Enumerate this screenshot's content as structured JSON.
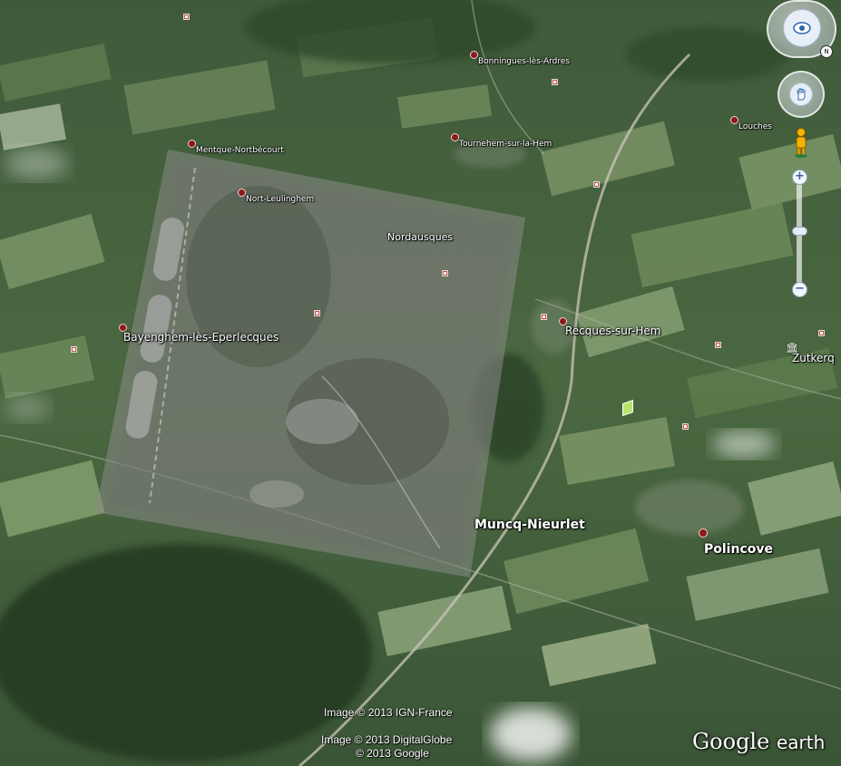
{
  "places": {
    "bonningues": "Bonningues-lès-Ardres",
    "louches": "Louches",
    "mentque": "Mentque-Nortbécourt",
    "tournehem": "Tournehem-sur-la-Hem",
    "nort": "Nort-Leulinghem",
    "nordausques": "Nordausques",
    "recques": "Recques-sur-Hem",
    "bayenghem": "Bayenghem-lès-Eperlecques",
    "zutkerque": "Zutkerq",
    "muncq": "Muncq-Nieurlet",
    "polincove": "Polincove"
  },
  "credits": {
    "ign": "Image © 2013 IGN-France",
    "digitalglobe": "Image © 2013 DigitalGlobe",
    "google": "© 2013 Google"
  },
  "logo": {
    "brand": "Google",
    "product": "earth"
  },
  "controls": {
    "zoom_in": "+",
    "zoom_out": "−"
  },
  "icons": {
    "navigation": "look-around-eye-icon",
    "move": "hand-move-icon",
    "street_view": "pegman-icon"
  }
}
